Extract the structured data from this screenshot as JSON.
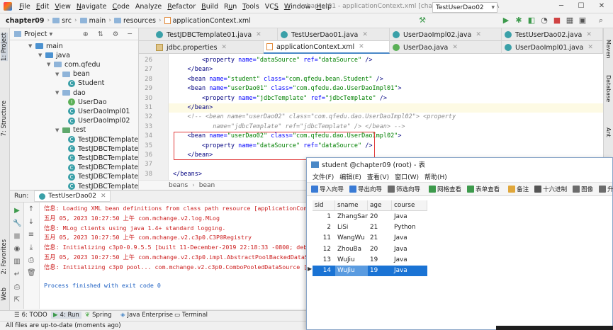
{
  "menubar": {
    "items": [
      {
        "label": "File",
        "mn": "F"
      },
      {
        "label": "Edit",
        "mn": "E"
      },
      {
        "label": "View",
        "mn": "V"
      },
      {
        "label": "Navigate",
        "mn": "N"
      },
      {
        "label": "Code",
        "mn": "C"
      },
      {
        "label": "Analyze",
        "mn": ""
      },
      {
        "label": "Refactor",
        "mn": "R"
      },
      {
        "label": "Build",
        "mn": "B"
      },
      {
        "label": "Run",
        "mn": "u"
      },
      {
        "label": "Tools",
        "mn": "T"
      },
      {
        "label": "VCS",
        "mn": "S"
      },
      {
        "label": "Window",
        "mn": "W"
      },
      {
        "label": "Help",
        "mn": "H"
      }
    ],
    "title": "chapter01 - applicationContext.xml [chapter09] - IntelliJ IDEA"
  },
  "navbar": {
    "crumbs": [
      "chapter09",
      "src",
      "main",
      "resources",
      "applicationContext.xml"
    ],
    "run_config": "TestUserDao02"
  },
  "left_strip": {
    "project": "1: Project",
    "structure": "7: Structure",
    "favorites": "2: Favorites",
    "web": "Web"
  },
  "right_strip": {
    "maven": "Maven",
    "database": "Database",
    "ant": "Ant"
  },
  "project_panel": {
    "title": "Project",
    "tree": [
      {
        "label": "main"
      },
      {
        "label": "java"
      },
      {
        "label": "com.qfedu"
      },
      {
        "label": "bean"
      },
      {
        "label": "Student"
      },
      {
        "label": "dao"
      },
      {
        "label": "UserDao"
      },
      {
        "label": "UserDaoImpl01"
      },
      {
        "label": "UserDaoImpl02"
      },
      {
        "label": "test"
      },
      {
        "label": "TestJDBCTemplate01"
      },
      {
        "label": "TestJDBCTemplate02"
      },
      {
        "label": "TestJDBCTemplate03"
      },
      {
        "label": "TestJDBCTemplate04"
      },
      {
        "label": "TestJDBCTemplate05"
      },
      {
        "label": "TestJDBCTemplate06"
      }
    ]
  },
  "editor_tabs_row1": [
    "TestJDBCTemplate01.java",
    "TestUserDao01.java",
    "UserDaoImpl02.java",
    "TestUserDao02.java"
  ],
  "editor_tabs_row2": [
    "jdbc.properties",
    "applicationContext.xml",
    "UserDao.java",
    "UserDaoImpl01.java"
  ],
  "editor": {
    "line_numbers": [
      "26",
      "27",
      "28",
      "29",
      "30",
      "31",
      "32",
      "33",
      "34",
      "35",
      "36",
      "37",
      "38"
    ],
    "lines": [
      {
        "parts": [
          [
            "t",
            "        <property "
          ],
          [
            "a",
            "name="
          ],
          [
            "v",
            "\"dataSource\" "
          ],
          [
            "a",
            "ref="
          ],
          [
            "v",
            "\"dataSource\""
          ],
          [
            "t",
            " />"
          ]
        ]
      },
      {
        "parts": [
          [
            "t",
            "    </bean>"
          ]
        ]
      },
      {
        "parts": [
          [
            "t",
            "    <bean "
          ],
          [
            "a",
            "name="
          ],
          [
            "v",
            "\"student\" "
          ],
          [
            "a",
            "class="
          ],
          [
            "v",
            "\"com.qfedu.bean.Student\""
          ],
          [
            "t",
            " />"
          ]
        ]
      },
      {
        "parts": [
          [
            "t",
            "    <bean "
          ],
          [
            "a",
            "name="
          ],
          [
            "v",
            "\"userDao01\" "
          ],
          [
            "a",
            "class="
          ],
          [
            "v",
            "\"com.qfedu.dao.UserDaoImpl01\""
          ],
          [
            "t",
            ">"
          ]
        ]
      },
      {
        "parts": [
          [
            "t",
            "        <property "
          ],
          [
            "a",
            "name="
          ],
          [
            "v",
            "\"jdbcTemplate\" "
          ],
          [
            "a",
            "ref="
          ],
          [
            "v",
            "\"jdbcTemplate\""
          ],
          [
            "t",
            " />"
          ]
        ]
      },
      {
        "parts": [
          [
            "t",
            "    </bean>"
          ]
        ]
      },
      {
        "parts": [
          [
            "c",
            "    <!-- <bean name=\"userDao02\" class=\"com.qfedu.dao.UserDaoImpl02\"> <property"
          ]
        ]
      },
      {
        "parts": [
          [
            "c",
            "           name=\"jdbcTemplate\" ref=\"jdbcTemplate\" /> </bean> -->"
          ]
        ]
      },
      {
        "parts": [
          [
            "t",
            "    <bean "
          ],
          [
            "a",
            "name="
          ],
          [
            "v",
            "\"userDao02\" "
          ],
          [
            "a",
            "class="
          ],
          [
            "v",
            "\"com.qfedu.dao.UserDaoImpl02\""
          ],
          [
            "t",
            ">"
          ]
        ]
      },
      {
        "parts": [
          [
            "t",
            "        <property "
          ],
          [
            "a",
            "name="
          ],
          [
            "v",
            "\"dataSource\" "
          ],
          [
            "a",
            "ref="
          ],
          [
            "v",
            "\"dataSource\""
          ],
          [
            "t",
            " />"
          ]
        ]
      },
      {
        "parts": [
          [
            "t",
            "    </bean>"
          ]
        ]
      },
      {
        "parts": [
          [
            "t",
            ""
          ]
        ]
      },
      {
        "parts": [
          [
            "t",
            "</beans>"
          ]
        ]
      }
    ],
    "breadcrumb": [
      "beans",
      "bean"
    ]
  },
  "run_panel": {
    "label": "Run:",
    "tab": "TestUserDao02",
    "console": [
      {
        "text": "信息: Loading XML bean definitions from class path resource [applicationContext.xm",
        "kind": "err"
      },
      {
        "text": "五月 05, 2023 10:27:50 上午 com.mchange.v2.log.MLog",
        "kind": "err"
      },
      {
        "text": "信息: MLog clients using java 1.4+ standard logging.",
        "kind": "err"
      },
      {
        "text": "五月 05, 2023 10:27:50 上午 com.mchange.v2.c3p0.C3P0Registry",
        "kind": "err"
      },
      {
        "text": "信息: Initializing c3p0-0.9.5.5 [built 11-December-2019 22:18:33 -0800; debug? tru",
        "kind": "err"
      },
      {
        "text": "五月 05, 2023 10:27:50 上午 com.mchange.v2.c3p0.impl.AbstractPoolBackedDataSource",
        "kind": "err"
      },
      {
        "text": "信息: Initializing c3p0 pool... com.mchange.v2.c3p0.ComboPooledDataSource [ acquir",
        "kind": "err"
      },
      {
        "text": "",
        "kind": "err"
      },
      {
        "text": "Process finished with exit code 0",
        "kind": "ok"
      }
    ]
  },
  "bottom_tabs": [
    "6: TODO",
    "4: Run",
    "Spring",
    "Java Enterprise",
    "Terminal"
  ],
  "status": "All files are up-to-date (moments ago)",
  "db_window": {
    "title": "student @chapter09 (root) - 表",
    "menu": [
      "文件(F)",
      "编辑(E)",
      "查看(V)",
      "窗口(W)",
      "帮助(H)"
    ],
    "tools": [
      "导入向导",
      "导出向导",
      "筛选向导",
      "网格查看",
      "表单查看",
      "备注",
      "十六进制",
      "图像",
      "升"
    ],
    "columns": [
      "sid",
      "sname",
      "age",
      "course"
    ],
    "rows": [
      [
        "1",
        "ZhangSan",
        "20",
        "Java"
      ],
      [
        "2",
        "LiSi",
        "21",
        "Python"
      ],
      [
        "11",
        "WangWu",
        "21",
        "Java"
      ],
      [
        "12",
        "ZhouBa",
        "20",
        "Java"
      ],
      [
        "13",
        "WuJiu",
        "19",
        "Java"
      ],
      [
        "14",
        "WuJiu",
        "19",
        "Java"
      ]
    ],
    "selected_row": 5
  }
}
